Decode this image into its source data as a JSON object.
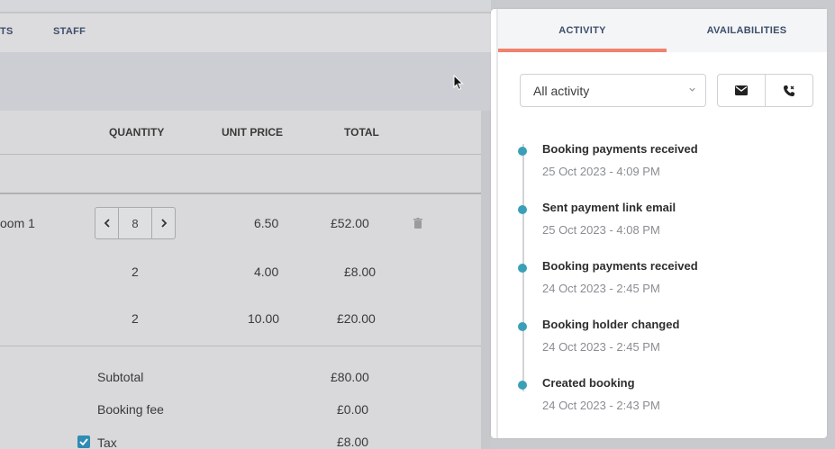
{
  "top_tabs": [
    "TS",
    "STAFF"
  ],
  "table": {
    "headers": {
      "quantity": "QUANTITY",
      "unit_price": "UNIT PRICE",
      "total": "TOTAL"
    },
    "rows": [
      {
        "name": "oom 1",
        "quantity": "8",
        "unit_price": "6.50",
        "total": "£52.00"
      },
      {
        "name": "",
        "quantity": "2",
        "unit_price": "4.00",
        "total": "£8.00"
      },
      {
        "name": "",
        "quantity": "2",
        "unit_price": "10.00",
        "total": "£20.00"
      }
    ],
    "summary": [
      {
        "label": "Subtotal",
        "value": "£80.00"
      },
      {
        "label": "Booking fee",
        "value": "£0.00"
      },
      {
        "label": "Tax",
        "value": "£8.00"
      }
    ]
  },
  "panel": {
    "tabs": [
      {
        "label": "ACTIVITY",
        "active": true
      },
      {
        "label": "AVAILABILITIES",
        "active": false
      }
    ],
    "filter": {
      "selected": "All activity"
    },
    "events": [
      {
        "title": "Booking payments received",
        "date": "25 Oct 2023 - 4:09 PM"
      },
      {
        "title": "Sent payment link email",
        "date": "25 Oct 2023 - 4:08 PM"
      },
      {
        "title": "Booking payments received",
        "date": "24 Oct 2023 - 2:45 PM"
      },
      {
        "title": "Booking holder changed",
        "date": "24 Oct 2023 - 2:45 PM"
      },
      {
        "title": "Created booking",
        "date": "24 Oct 2023 - 2:43 PM"
      }
    ]
  },
  "colors": {
    "accent_tab": "#f0826e",
    "timeline_dot": "#3aa0b8",
    "checkbox": "#2e8cb5"
  },
  "icons": [
    "chevron-left-icon",
    "chevron-right-icon",
    "trash-icon",
    "checkbox-checked-icon",
    "chevron-down-icon",
    "email-icon",
    "phone-icon",
    "cursor-icon"
  ]
}
